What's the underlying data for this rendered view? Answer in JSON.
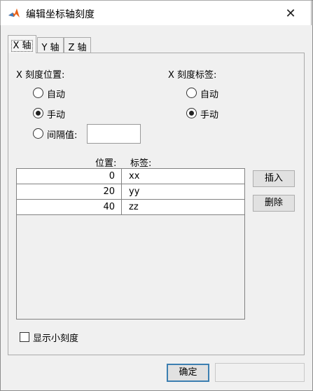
{
  "window": {
    "title": "编辑坐标轴刻度",
    "close_symbol": "✕"
  },
  "tabs": [
    {
      "label": "X 轴",
      "active": true
    },
    {
      "label": "Y 轴",
      "active": false
    },
    {
      "label": "Z 轴",
      "active": false
    }
  ],
  "tick_position": {
    "heading": "X 刻度位置:",
    "options": [
      {
        "label": "自动",
        "checked": false
      },
      {
        "label": "手动",
        "checked": true
      },
      {
        "label": "间隔值:",
        "checked": false
      }
    ],
    "interval_value": ""
  },
  "tick_labels": {
    "heading": "X 刻度标签:",
    "options": [
      {
        "label": "自动",
        "checked": false
      },
      {
        "label": "手动",
        "checked": true
      }
    ]
  },
  "table": {
    "headers": {
      "position": "位置:",
      "label": "标签:"
    },
    "rows": [
      {
        "position": "0",
        "label": "xx"
      },
      {
        "position": "20",
        "label": "yy"
      },
      {
        "position": "40",
        "label": "zz"
      }
    ]
  },
  "side_buttons": {
    "insert": "插入",
    "delete": "删除"
  },
  "minor_ticks": {
    "label": "显示小刻度",
    "checked": false
  },
  "footer": {
    "ok": "确定",
    "cancel": ""
  },
  "colors": {
    "matlab_orange": "#e8631b",
    "default_button_border": "#3c7fb1"
  }
}
